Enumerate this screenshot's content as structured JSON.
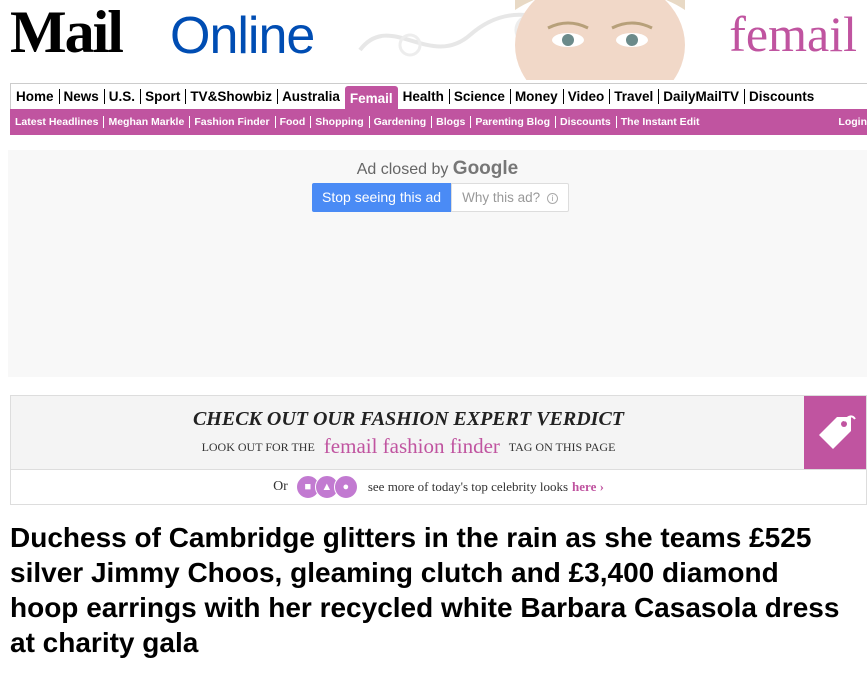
{
  "masthead": {
    "logo_mail": "Mail",
    "logo_online": "Online",
    "section_brand": "femail"
  },
  "nav": {
    "primary": [
      {
        "label": "Home"
      },
      {
        "label": "News"
      },
      {
        "label": "U.S."
      },
      {
        "label": "Sport"
      },
      {
        "label": "TV&Showbiz"
      },
      {
        "label": "Australia"
      },
      {
        "label": "Femail",
        "active": true
      },
      {
        "label": "Health"
      },
      {
        "label": "Science"
      },
      {
        "label": "Money"
      },
      {
        "label": "Video"
      },
      {
        "label": "Travel"
      },
      {
        "label": "DailyMailTV"
      },
      {
        "label": "Discounts"
      }
    ],
    "secondary": [
      {
        "label": "Latest Headlines"
      },
      {
        "label": "Meghan Markle"
      },
      {
        "label": "Fashion Finder"
      },
      {
        "label": "Food"
      },
      {
        "label": "Shopping"
      },
      {
        "label": "Gardening"
      },
      {
        "label": "Blogs"
      },
      {
        "label": "Parenting Blog"
      },
      {
        "label": "Discounts"
      },
      {
        "label": "The Instant Edit"
      }
    ],
    "login_label": "Login"
  },
  "ad": {
    "closed_by": "Ad closed by",
    "google": "Google",
    "stop_button": "Stop seeing this ad",
    "why_button": "Why this ad?",
    "info_icon": "i"
  },
  "fashion_finder": {
    "title": "CHECK OUT OUR FASHION EXPERT VERDICT",
    "look_out": "LOOK OUT FOR THE",
    "finder_label": "femail fashion finder",
    "tag_on_page": "TAG ON THIS PAGE",
    "or": "Or",
    "see_more": "see more of today's top celebrity looks",
    "here_link": "here ›",
    "tag_color": "#c054a0"
  },
  "article": {
    "headline": "Duchess of Cambridge glitters in the rain as she teams £525 silver Jimmy Choos, gleaming clutch and £3,400 diamond hoop earrings with her recycled white Barbara Casasola dress at charity gala"
  },
  "colors": {
    "femail_pink": "#c054a0",
    "online_blue": "#004db3",
    "google_button_blue": "#4a8bf5"
  }
}
